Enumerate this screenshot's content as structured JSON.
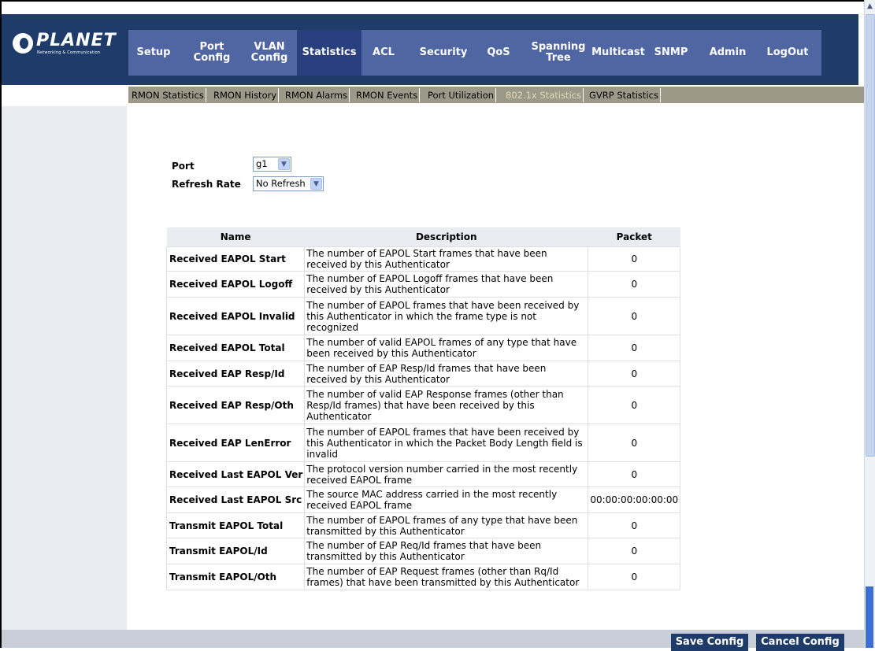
{
  "brand": {
    "name": "PLANET",
    "tagline": "Networking & Communication"
  },
  "main_nav": [
    {
      "label": "Setup"
    },
    {
      "label": "Port\nConfig"
    },
    {
      "label": "VLAN\nConfig"
    },
    {
      "label": "Statistics"
    },
    {
      "label": "ACL"
    },
    {
      "label": "Security"
    },
    {
      "label": "QoS"
    },
    {
      "label": "Spanning\nTree"
    },
    {
      "label": "Multicast"
    },
    {
      "label": "SNMP"
    },
    {
      "label": "Admin"
    },
    {
      "label": "LogOut"
    }
  ],
  "sub_nav": [
    {
      "label": "RMON Statistics"
    },
    {
      "label": "RMON History"
    },
    {
      "label": "RMON Alarms"
    },
    {
      "label": "RMON Events"
    },
    {
      "label": "Port Utilization"
    },
    {
      "label": "802.1x Statistics"
    },
    {
      "label": "GVRP Statistics"
    }
  ],
  "form": {
    "port_label": "Port",
    "port_value": "g1",
    "refresh_label": "Refresh Rate",
    "refresh_value": "No Refresh"
  },
  "table": {
    "headers": [
      "Name",
      "Description",
      "Packet"
    ],
    "rows": [
      {
        "name": "Received EAPOL Start",
        "description": "The number of EAPOL Start frames that have been received by this Authenticator",
        "packet": "0"
      },
      {
        "name": "Received EAPOL Logoff",
        "description": "The number of EAPOL Logoff frames that have been received by this Authenticator",
        "packet": "0"
      },
      {
        "name": "Received EAPOL Invalid",
        "description": "The number of EAPOL frames that have been received by this Authenticator in which the frame type is not recognized",
        "packet": "0"
      },
      {
        "name": "Received EAPOL Total",
        "description": "The number of valid EAPOL frames of any type that have been received by this Authenticator",
        "packet": "0"
      },
      {
        "name": "Received EAP Resp/Id",
        "description": "The number of EAP Resp/Id frames that have been received by this Authenticator",
        "packet": "0"
      },
      {
        "name": "Received EAP Resp/Oth",
        "description": "The number of valid EAP Response frames (other than Resp/Id frames) that have been received by this Authenticator",
        "packet": "0"
      },
      {
        "name": "Received EAP LenError",
        "description": "The number of EAPOL frames that have been received by this Authenticator in which the Packet Body Length field is invalid",
        "packet": "0"
      },
      {
        "name": "Received Last EAPOL Ver",
        "description": "The protocol version number carried in the most recently received EAPOL frame",
        "packet": "0"
      },
      {
        "name": "Received Last EAPOL Src",
        "description": "The source MAC address carried in the most recently received EAPOL frame",
        "packet": "00:00:00:00:00:00"
      },
      {
        "name": "Transmit EAPOL Total",
        "description": "The number of EAPOL frames of any type that have been transmitted by this Authenticator",
        "packet": "0"
      },
      {
        "name": "Transmit EAPOL/Id",
        "description": "The number of EAP Req/Id frames that have been transmitted by this Authenticator",
        "packet": "0"
      },
      {
        "name": "Transmit EAPOL/Oth",
        "description": "The number of EAP Request frames (other than Rq/Id frames) that have been transmitted by this Authenticator",
        "packet": "0"
      }
    ]
  },
  "buttons": {
    "save": "Save Config",
    "cancel": "Cancel Config"
  },
  "colors": {
    "nav_dark": "#1f3b6a",
    "nav_bar": "#4f66a3",
    "nav_active": "#2a3f7d",
    "sub_nav": "#9d9988",
    "left_column": "#e9ecf0"
  }
}
